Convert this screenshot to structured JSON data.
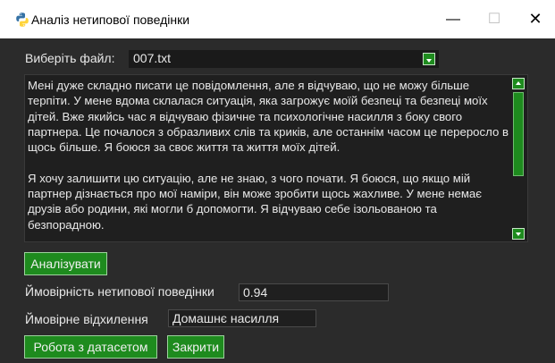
{
  "window": {
    "title": "Аналіз нетипової поведінки",
    "minimize_glyph": "—",
    "maximize_glyph": "☐",
    "close_glyph": "✕",
    "icon": "python-icon"
  },
  "file": {
    "label": "Виберіть файл:",
    "selected": "007.txt"
  },
  "message": {
    "text": "Мені дуже складно писати це повідомлення, але я відчуваю, що не можу більше терпіти. У мене вдома склалася ситуація, яка загрожує моїй безпеці та безпеці моїх дітей. Вже якийсь час я відчуваю фізичне та психологічне насилля з боку свого партнера. Це почалося з образливих слів та криків, але останнім часом це переросло в щось більше. Я боюся за своє життя та життя моїх дітей.\n\nЯ хочу залишити цю ситуацію, але не знаю, з чого почати. Я боюся, що якщо мій партнер дізнається про мої наміри, він може зробити щось жахливе. У мене немає друзів або родини, які могли б допомогти. Я відчуваю себе ізольованою та безпорадною."
  },
  "actions": {
    "analyze": "Аналізувати",
    "dataset": "Робота з датасетом",
    "close": "Закрити"
  },
  "results": {
    "probability_label": "Ймовірність нетипової поведінки",
    "probability_value": "0.94",
    "deviation_label": "Ймовірне відхилення",
    "deviation_value": "Домашнє насилля"
  },
  "colors": {
    "accent_green": "#1e8b1e",
    "background": "#2b2b2b",
    "field": "#1f1f1f"
  }
}
